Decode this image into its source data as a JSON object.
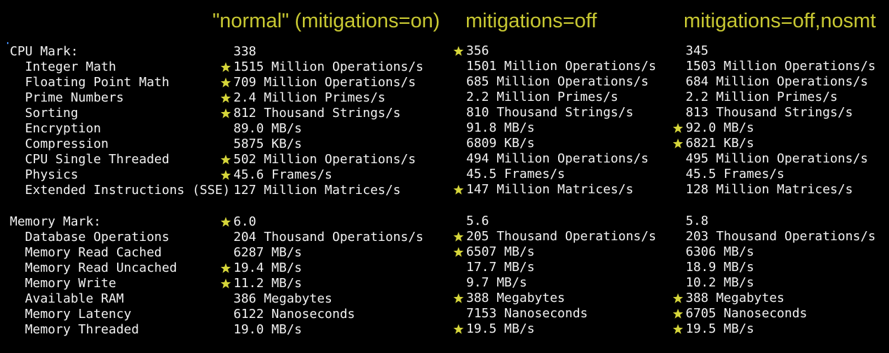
{
  "headers": [
    "\"normal\" (mitigations=on)",
    "mitigations=off",
    "mitigations=off,nosmt"
  ],
  "colors": {
    "header": "#c8c832",
    "text": "#f2f2f2",
    "star": "#d6d63a",
    "background": "#000000"
  },
  "icon": "star-icon",
  "rows": [
    {
      "label": "CPU Mark:",
      "values": [
        "338",
        "356",
        "345"
      ],
      "best": [
        false,
        true,
        false
      ]
    },
    {
      "label": "  Integer Math",
      "values": [
        "1515 Million Operations/s",
        "1501 Million Operations/s",
        "1503 Million Operations/s"
      ],
      "best": [
        true,
        false,
        false
      ]
    },
    {
      "label": "  Floating Point Math",
      "values": [
        "709 Million Operations/s",
        "685 Million Operations/s",
        "684 Million Operations/s"
      ],
      "best": [
        true,
        false,
        false
      ]
    },
    {
      "label": "  Prime Numbers",
      "values": [
        "2.4 Million Primes/s",
        "2.2 Million Primes/s",
        "2.2 Million Primes/s"
      ],
      "best": [
        true,
        false,
        false
      ]
    },
    {
      "label": "  Sorting",
      "values": [
        "812 Thousand Strings/s",
        "810 Thousand Strings/s",
        "813 Thousand Strings/s"
      ],
      "best": [
        true,
        false,
        false
      ]
    },
    {
      "label": "  Encryption",
      "values": [
        "89.0 MB/s",
        "91.8 MB/s",
        "92.0 MB/s"
      ],
      "best": [
        false,
        false,
        true
      ]
    },
    {
      "label": "  Compression",
      "values": [
        "5875 KB/s",
        "6809 KB/s",
        "6821 KB/s"
      ],
      "best": [
        false,
        false,
        true
      ]
    },
    {
      "label": "  CPU Single Threaded",
      "values": [
        "502 Million Operations/s",
        "494 Million Operations/s",
        "495 Million Operations/s"
      ],
      "best": [
        true,
        false,
        false
      ]
    },
    {
      "label": "  Physics",
      "values": [
        "45.6 Frames/s",
        "45.5 Frames/s",
        "45.5 Frames/s"
      ],
      "best": [
        true,
        false,
        false
      ]
    },
    {
      "label": "  Extended Instructions (SSE)",
      "values": [
        "127 Million Matrices/s",
        "147 Million Matrices/s",
        "128 Million Matrices/s"
      ],
      "best": [
        false,
        true,
        false
      ]
    },
    {
      "label": "Memory Mark:",
      "values": [
        "6.0",
        "5.6",
        "5.8"
      ],
      "best": [
        true,
        false,
        false
      ]
    },
    {
      "label": "  Database Operations",
      "values": [
        "204 Thousand Operations/s",
        "205 Thousand Operations/s",
        "203 Thousand Operations/s"
      ],
      "best": [
        false,
        true,
        false
      ]
    },
    {
      "label": "  Memory Read Cached",
      "values": [
        "6287 MB/s",
        "6507 MB/s",
        "6306 MB/s"
      ],
      "best": [
        false,
        true,
        false
      ]
    },
    {
      "label": "  Memory Read Uncached",
      "values": [
        "19.4 MB/s",
        "17.7 MB/s",
        "18.9 MB/s"
      ],
      "best": [
        true,
        false,
        false
      ]
    },
    {
      "label": "  Memory Write",
      "values": [
        "11.2 MB/s",
        "9.7 MB/s",
        "10.2 MB/s"
      ],
      "best": [
        true,
        false,
        false
      ]
    },
    {
      "label": "  Available RAM",
      "values": [
        "386 Megabytes",
        "388 Megabytes",
        "388 Megabytes"
      ],
      "best": [
        false,
        true,
        true
      ]
    },
    {
      "label": "  Memory Latency",
      "values": [
        "6122 Nanoseconds",
        "7153 Nanoseconds",
        "6705 Nanoseconds"
      ],
      "best": [
        false,
        false,
        true
      ]
    },
    {
      "label": "  Memory Threaded",
      "values": [
        "19.0 MB/s",
        "19.5 MB/s",
        "19.5 MB/s"
      ],
      "best": [
        false,
        true,
        true
      ]
    }
  ]
}
